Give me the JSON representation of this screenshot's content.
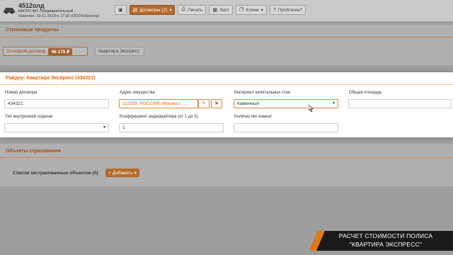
{
  "header": {
    "policy_number": "4512олд",
    "policy_type": "КАСКО ФЛ. Предварительный",
    "changed": "Изменен: 29.11.2019 в 17:33 (ООО№Брокер)"
  },
  "toolbar": {
    "contracts_label": "Договоры (2)",
    "print_label": "Печать",
    "sheet_label": "Лист",
    "copy_label": "Копии",
    "problem_label": "Проблема?"
  },
  "products": {
    "section_title": "Страховые продукты",
    "main_label": "Основной договор",
    "main_price": "46 175 ₽",
    "express_label": "Квартира Экспресс"
  },
  "modal": {
    "title": "Райдер: Квартира Экспресс (434321)",
    "contract_number_label": "Номер договора",
    "contract_number_value": "434321",
    "address_label": "Адрес имущества",
    "address_value": "111555, РОССИЯ, Москва г, ...",
    "wall_material_label": "Материал капитальных стен",
    "wall_material_value": "Каменный",
    "area_label": "Общая площадь",
    "area_value": "",
    "finish_label": "Тип внутренней отделки",
    "finish_value": "",
    "coef_label": "Коэффициент андеррайтера (от 1 до 3)",
    "coef_value": "1",
    "rooms_label": "Количество комнат",
    "rooms_value": ""
  },
  "objects": {
    "section_title": "Объекты страхования",
    "insured_list_label": "Список застрахованных объектов (0)",
    "add_label": "Добавить"
  },
  "banner": {
    "line1": "РАСЧЕТ СТОИМОСТИ ПОЛИСА",
    "line2": "\"КВАРТИРА ЭКСПРЕСС\""
  },
  "colors": {
    "accent": "#e06a10",
    "banner_bg": "#1a1a1a"
  }
}
